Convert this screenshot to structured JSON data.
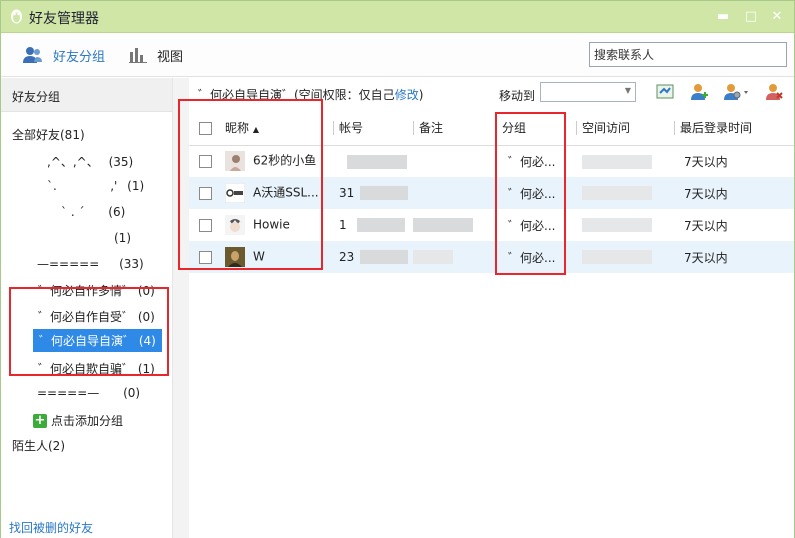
{
  "window": {
    "title": "好友管理器",
    "controls": {
      "minimize": "▬",
      "maximize": "□",
      "close": "✕"
    }
  },
  "toolbar": {
    "friends_label": "好友分组",
    "view_label": "视图",
    "search_placeholder": "搜索联系人"
  },
  "sidebar": {
    "header": "好友分组",
    "all_friends": "全部好友(81)",
    "groups": [
      {
        "label": ",^、,^、",
        "count": "(35)"
      },
      {
        "label": "`.              ,'",
        "count": "(1)"
      },
      {
        "label": "` .  ´",
        "count": "(6)"
      },
      {
        "label": "",
        "count": "(1)"
      },
      {
        "label": "—=====",
        "count": "(33)"
      },
      {
        "label": "゛何必自作多情゛",
        "count": "(0)"
      },
      {
        "label": "゛何必自作自受゛",
        "count": "(0)"
      },
      {
        "label": "゛何必自导自演゛",
        "count": "(4)"
      },
      {
        "label": "゛何必自欺自骗゛",
        "count": "(1)"
      },
      {
        "label": "=====—",
        "count": "(0)"
      }
    ],
    "add_group": "点击添加分组",
    "strangers": "陌生人(2)",
    "recover": "找回被删的好友"
  },
  "main": {
    "info_prefix": "゛何必自导自演゛(空间权限：仅自己",
    "info_link": "修改",
    "info_suffix": ")",
    "move_to_label": "移动到",
    "columns": {
      "nickname": "昵称",
      "sort_arrow": "▲",
      "account": "帐号",
      "remark": "备注",
      "group": "分组",
      "space": "空间访问",
      "last_login": "最后登录时间"
    },
    "rows": [
      {
        "nickname": "62秒的小鱼",
        "account": "",
        "group": "゛何必...",
        "last_login": "7天以内"
      },
      {
        "nickname": "A沃通SSL...",
        "account": "31",
        "group": "゛何必...",
        "last_login": "7天以内"
      },
      {
        "nickname": "Howie",
        "account": "1",
        "group": "゛何必...",
        "last_login": "7天以内"
      },
      {
        "nickname": "W",
        "account": "23",
        "group": "゛何必...",
        "last_login": "7天以内"
      }
    ]
  },
  "colors": {
    "titlebar": "#cfe6a6",
    "accent_blue": "#2b78c5",
    "selection": "#2e8ae6",
    "highlight_red": "#e8262b",
    "row_stripe": "#e8f3fb"
  },
  "icons": [
    "qq-penguin-icon",
    "friends-icon",
    "bar-chart-icon",
    "move-icon",
    "add-friend-icon",
    "user-settings-icon",
    "delete-friend-icon",
    "plus-icon"
  ]
}
